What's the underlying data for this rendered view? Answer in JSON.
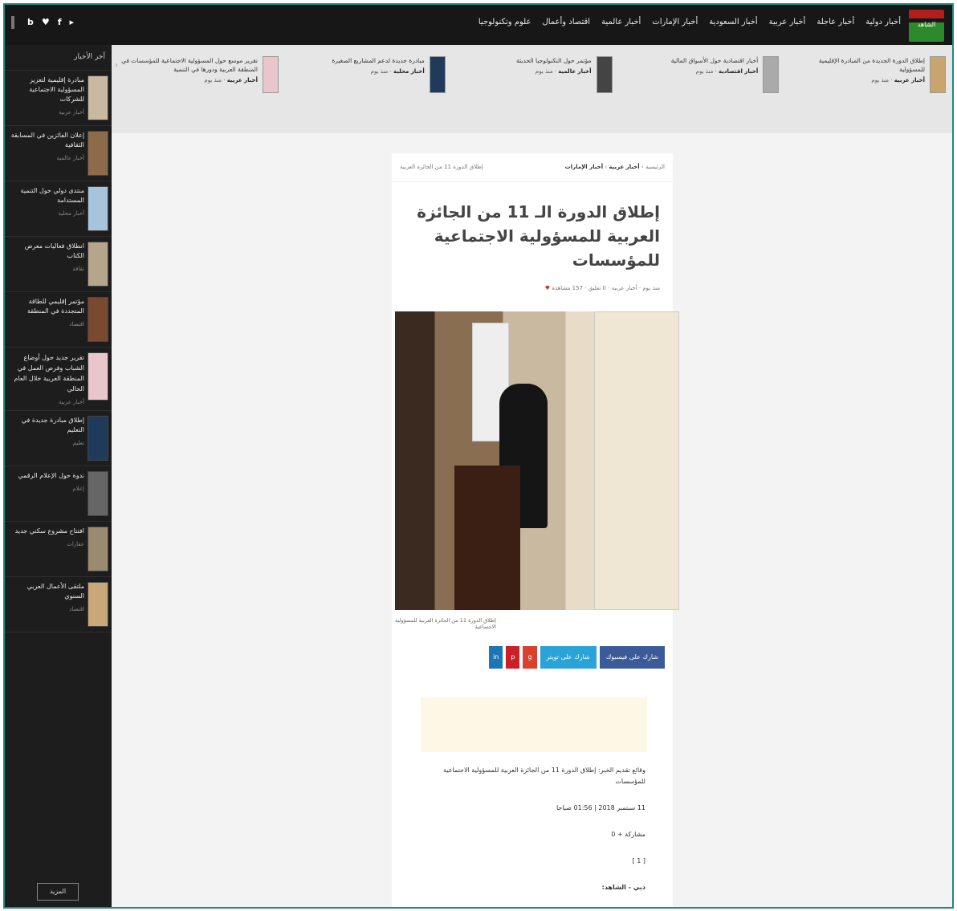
{
  "topbar": {
    "logo_text": "الشاهد",
    "nav": [
      "أخبار دولية",
      "أخبار عاجلة",
      "أخبار عربية",
      "أخبار السعودية",
      "أخبار الإمارات",
      "أخبار عالمية",
      "اقتصاد وأعمال",
      "علوم وتكنولوجيا"
    ],
    "social": [
      "b",
      "♥",
      "f",
      "▸"
    ]
  },
  "sidebar": {
    "heading": "آخر الأخبار",
    "items": [
      {
        "title": "مبادرة إقليمية لتعزيز المسؤولية الاجتماعية للشركات",
        "meta": "أخبار عربية"
      },
      {
        "title": "إعلان الفائزين في المسابقة الثقافية",
        "meta": "أخبار عالمية"
      },
      {
        "title": "منتدى دولي حول التنمية المستدامة",
        "meta": "أخبار محلية"
      },
      {
        "title": "انطلاق فعاليات معرض الكتاب",
        "meta": "ثقافة"
      },
      {
        "title": "مؤتمر إقليمي للطاقة المتجددة في المنطقة",
        "meta": "اقتصاد"
      },
      {
        "title": "تقرير جديد حول أوضاع الشباب وفرص العمل في المنطقة العربية خلال العام الحالي",
        "meta": "أخبار عربية"
      },
      {
        "title": "إطلاق مبادرة جديدة في التعليم",
        "meta": "تعليم"
      },
      {
        "title": "ندوة حول الإعلام الرقمي",
        "meta": "إعلام"
      },
      {
        "title": "افتتاح مشروع سكني جديد",
        "meta": "عقارات"
      },
      {
        "title": "ملتقى الأعمال العربي السنوي",
        "meta": "اقتصاد"
      }
    ],
    "more_label": "المزيد"
  },
  "strip": [
    {
      "title": "إطلاق الدورة الجديدة من المبادرة الإقليمية للمسؤولية",
      "cat": "أخبار عربية",
      "date": "منذ يوم"
    },
    {
      "title": "أخبار اقتصادية حول الأسواق المالية",
      "cat": "أخبار اقتصادية",
      "date": "منذ يوم"
    },
    {
      "title": "مؤتمر حول التكنولوجيا الحديثة",
      "cat": "أخبار عالمية",
      "date": "منذ يوم"
    },
    {
      "title": "مبادرة جديدة لدعم المشاريع الصغيرة",
      "cat": "أخبار محلية",
      "date": "منذ يوم"
    },
    {
      "title": "تقرير موسع حول المسؤولية الاجتماعية للمؤسسات في المنطقة العربية ودورها في التنمية",
      "cat": "أخبار عربية",
      "date": "منذ يوم"
    }
  ],
  "article": {
    "breadcrumb": [
      "الرئيسية",
      "أخبار عربية",
      "أخبار الإمارات"
    ],
    "breadcrumb_right": "إطلاق الدورة 11 من الجائزة العربية",
    "headline": "إطلاق الدورة الـ 11 من الجائزة العربية للمسؤولية الاجتماعية للمؤسسات",
    "meta": "منذ يوم · أخبار عربية · 0 تعليق · 157 مشاهدة",
    "caption": "إطلاق الدورة 11 من الجائزة العربية للمسؤولية الاجتماعية",
    "share": {
      "facebook": "شارك على فيسبوك",
      "twitter": "شارك على تويتر"
    },
    "paragraphs": [
      "وقائع تقديم الخبر: إطلاق الدورة 11 من الجائزة العربية للمسؤولية الاجتماعية للمؤسسات",
      "11 سبتمبر 2018 | 01:56 صباحا",
      "مشاركة + 0",
      "[ 1 ]",
      "دبي - الشاهد:"
    ]
  }
}
